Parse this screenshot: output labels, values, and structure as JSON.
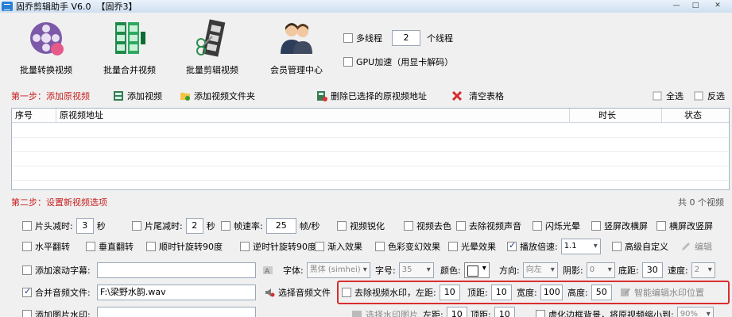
{
  "window": {
    "title": "固乔剪辑助手 V6.0  【固乔3】",
    "min": "—",
    "max": "□",
    "close": "✕"
  },
  "toolbar": {
    "buttons": [
      "批量转换视频",
      "批量合并视频",
      "批量剪辑视频",
      "会员管理中心"
    ],
    "multithread_label": "多线程",
    "thread_count": "2",
    "thread_unit": "个线程",
    "gpu_label": "GPU加速（用显卡解码）"
  },
  "step1": {
    "title": "第一步：添加原视频",
    "add_video": "添加视频",
    "add_folder": "添加视频文件夹",
    "delete_selected": "删除已选择的原视频地址",
    "clear_table": "清空表格",
    "select_all": "全选",
    "invert": "反选"
  },
  "table": {
    "columns": [
      "序号",
      "原视频地址",
      "时长",
      "状态"
    ]
  },
  "step2": {
    "title": "第二步：设置新视频选项",
    "count": "共 0 个视频"
  },
  "options": {
    "r1": {
      "head_cut": "片头减时:",
      "head_val": "3",
      "sec1": "秒",
      "tail_cut": "片尾减时:",
      "tail_val": "2",
      "sec2": "秒",
      "fps": "帧速率:",
      "fps_val": "25",
      "fps_unit": "帧/秒",
      "sharpen": "视频锐化",
      "decolor": "视频去色",
      "remove_audio": "去除视频声音",
      "flash": "闪烁光晕",
      "portrait_landscape": "竖屏改横屏",
      "landscape_portrait": "横屏改竖屏"
    },
    "r2": {
      "hflip": "水平翻转",
      "vflip": "垂直翻转",
      "rot_cw": "顺时针旋转90度",
      "rot_ccw": "逆时针旋转90度",
      "fade_in": "渐入效果",
      "color_change": "色彩变幻效果",
      "light": "光晕效果",
      "speed": "播放倍速:",
      "speed_val": "1.1",
      "custom": "高级自定义",
      "edit": "编辑"
    },
    "r3": {
      "scroll": "添加滚动字幕:",
      "font": "字体:",
      "font_val": "黑体 (simhei)",
      "size": "字号:",
      "size_val": "35",
      "color": "颜色:",
      "direction": "方向:",
      "direction_val": "向左",
      "shadow": "阴影:",
      "shadow_val": "0",
      "bottom": "底距:",
      "bottom_val": "30",
      "speed": "速度:",
      "speed_val": "2"
    },
    "r4": {
      "merge_audio": "合并音频文件:",
      "audio_path": "F:\\梁野水韵.wav",
      "choose_audio": "选择音频文件",
      "remove_watermark": "去除视频水印，左距:",
      "left_val": "10",
      "top": "顶距:",
      "top_val": "10",
      "width": "宽度:",
      "width_val": "100",
      "height": "高度:",
      "height_val": "50",
      "smart_edit": "智能编辑水印位置"
    },
    "r5": {
      "image_watermark": "添加图片水印:",
      "choose_image": "选择水印图片",
      "left": "左距:",
      "left_val": "10",
      "top": "顶距:",
      "top_val": "10",
      "blur_bg": "虚化边框背景，将原视频缩小到:",
      "blur_val": "90%"
    }
  }
}
